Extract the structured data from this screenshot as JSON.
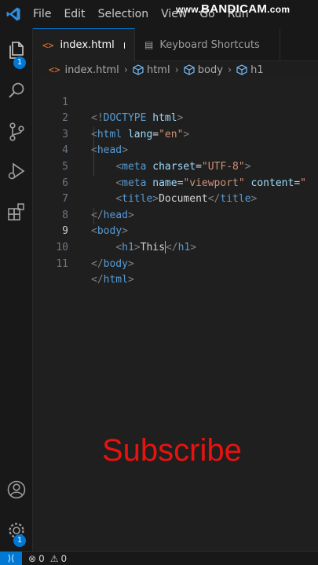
{
  "menu": {
    "items": [
      "File",
      "Edit",
      "Selection",
      "View",
      "Go",
      "Run"
    ]
  },
  "watermark": {
    "prefix": "www.",
    "brand": "BANDICAM",
    "suffix": ".com"
  },
  "activity": {
    "explorer_badge": "1",
    "manage_badge": "1"
  },
  "tabs": [
    {
      "label": "index.html",
      "active": true,
      "modified": true,
      "icon": "html-icon"
    },
    {
      "label": "Keyboard Shortcuts",
      "active": false,
      "icon": "keyboard-icon"
    }
  ],
  "breadcrumb": {
    "file": "index.html",
    "items": [
      "html",
      "body",
      "h1"
    ]
  },
  "editor": {
    "line_numbers": [
      "1",
      "2",
      "3",
      "4",
      "5",
      "6",
      "7",
      "8",
      "9",
      "10",
      "11"
    ],
    "current_line": 9,
    "lines": [
      "<!DOCTYPE html>",
      "<html lang=\"en\">",
      "<head>",
      "    <meta charset=\"UTF-8\">",
      "    <meta name=\"viewport\" content=\"",
      "    <title>Document</title>",
      "</head>",
      "<body>",
      "    <h1>This</h1>",
      "</body>",
      "</html>"
    ]
  },
  "overlay": {
    "subscribe": "Subscribe"
  },
  "statusbar": {
    "errors": "0",
    "warnings": "0"
  },
  "colors": {
    "accent": "#0078d4",
    "tag": "#569cd6",
    "attr": "#9cdcfe",
    "string": "#ce9178",
    "subscribe": "#e8130e"
  }
}
